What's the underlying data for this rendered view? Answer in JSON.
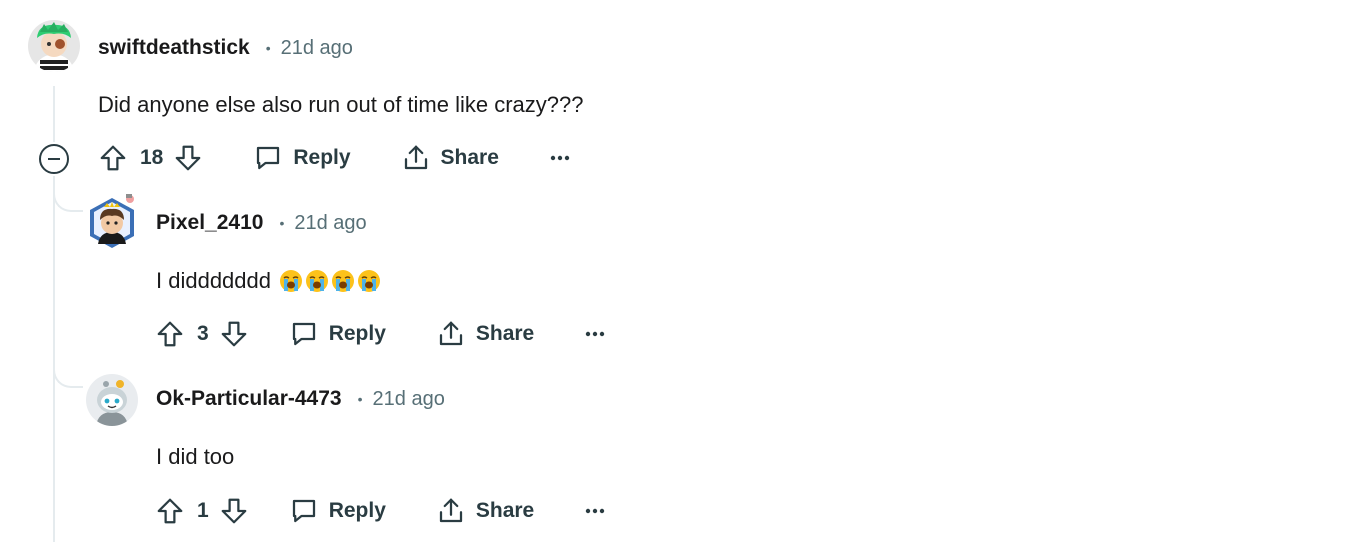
{
  "comments": [
    {
      "username": "swiftdeathstick",
      "time": "21d ago",
      "text": "Did anyone else also run out of time like crazy???",
      "votes": "18",
      "reply_label": "Reply",
      "share_label": "Share"
    },
    {
      "username": "Pixel_2410",
      "time": "21d ago",
      "text": "I diddddddd",
      "emoji": [
        "loudly-crying-face",
        "loudly-crying-face",
        "loudly-crying-face",
        "loudly-crying-face"
      ],
      "votes": "3",
      "reply_label": "Reply",
      "share_label": "Share"
    },
    {
      "username": "Ok-Particular-4473",
      "time": "21d ago",
      "text": "I did too",
      "votes": "1",
      "reply_label": "Reply",
      "share_label": "Share"
    }
  ],
  "separator": "•",
  "colors": {
    "text": "#1a1a1b",
    "meta": "#576f76",
    "action": "#2a3c42",
    "thread_line": "#e5ebee"
  }
}
